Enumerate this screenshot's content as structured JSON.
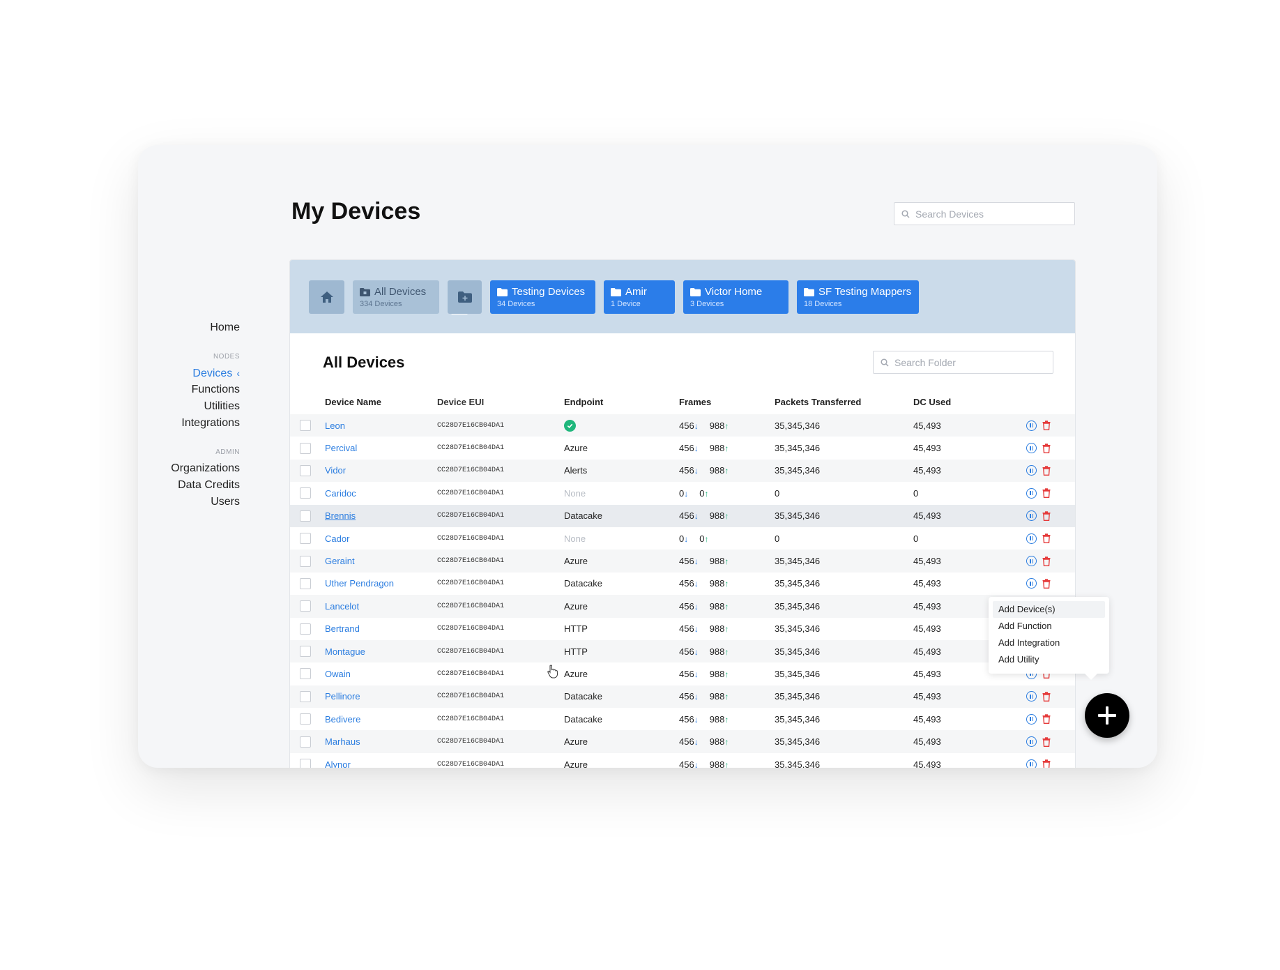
{
  "header": {
    "title": "My Devices",
    "search_placeholder": "Search Devices"
  },
  "sidebar": {
    "home": "Home",
    "nodes_label": "NODES",
    "nodes": [
      "Devices",
      "Functions",
      "Utilities",
      "Integrations"
    ],
    "admin_label": "ADMIN",
    "admin": [
      "Organizations",
      "Data Credits",
      "Users"
    ]
  },
  "folders": {
    "all": {
      "title": "All Devices",
      "sub": "334 Devices"
    },
    "items": [
      {
        "title": "Testing Devices",
        "sub": "34 Devices"
      },
      {
        "title": "Amir",
        "sub": "1 Device"
      },
      {
        "title": "Victor Home",
        "sub": "3 Devices"
      },
      {
        "title": "SF Testing Mappers",
        "sub": "18 Devices"
      }
    ]
  },
  "main": {
    "title": "All Devices",
    "search_placeholder": "Search Folder"
  },
  "table": {
    "columns": [
      "Device Name",
      "Device EUI",
      "Endpoint",
      "Frames",
      "Packets Transferred",
      "DC Used"
    ],
    "rows": [
      {
        "name": "Leon",
        "eui": "CC28D7E16CB04DA1",
        "endpoint": "",
        "status_icon": "check-circle",
        "down": "456",
        "up": "988",
        "packets": "35,345,346",
        "dc": "45,493"
      },
      {
        "name": "Percival",
        "eui": "CC28D7E16CB04DA1",
        "endpoint": "Azure",
        "down": "456",
        "up": "988",
        "packets": "35,345,346",
        "dc": "45,493"
      },
      {
        "name": "Vidor",
        "eui": "CC28D7E16CB04DA1",
        "endpoint": "Alerts",
        "down": "456",
        "up": "988",
        "packets": "35,345,346",
        "dc": "45,493"
      },
      {
        "name": "Caridoc",
        "eui": "CC28D7E16CB04DA1",
        "endpoint": "None",
        "muted": true,
        "down": "0",
        "up": "0",
        "packets": "0",
        "dc": "0"
      },
      {
        "name": "Brennis",
        "eui": "CC28D7E16CB04DA1",
        "endpoint": "Datacake",
        "hovered": true,
        "down": "456",
        "up": "988",
        "packets": "35,345,346",
        "dc": "45,493"
      },
      {
        "name": "Cador",
        "eui": "CC28D7E16CB04DA1",
        "endpoint": "None",
        "muted": true,
        "down": "0",
        "up": "0",
        "packets": "0",
        "dc": "0"
      },
      {
        "name": "Geraint",
        "eui": "CC28D7E16CB04DA1",
        "endpoint": "Azure",
        "down": "456",
        "up": "988",
        "packets": "35,345,346",
        "dc": "45,493"
      },
      {
        "name": "Uther Pendragon",
        "eui": "CC28D7E16CB04DA1",
        "endpoint": "Datacake",
        "down": "456",
        "up": "988",
        "packets": "35,345,346",
        "dc": "45,493"
      },
      {
        "name": "Lancelot",
        "eui": "CC28D7E16CB04DA1",
        "endpoint": "Azure",
        "down": "456",
        "up": "988",
        "packets": "35,345,346",
        "dc": "45,493"
      },
      {
        "name": "Bertrand",
        "eui": "CC28D7E16CB04DA1",
        "endpoint": "HTTP",
        "down": "456",
        "up": "988",
        "packets": "35,345,346",
        "dc": "45,493"
      },
      {
        "name": "Montague",
        "eui": "CC28D7E16CB04DA1",
        "endpoint": "HTTP",
        "down": "456",
        "up": "988",
        "packets": "35,345,346",
        "dc": "45,493"
      },
      {
        "name": "Owain",
        "eui": "CC28D7E16CB04DA1",
        "endpoint": "Azure",
        "down": "456",
        "up": "988",
        "packets": "35,345,346",
        "dc": "45,493"
      },
      {
        "name": "Pellinore",
        "eui": "CC28D7E16CB04DA1",
        "endpoint": "Datacake",
        "down": "456",
        "up": "988",
        "packets": "35,345,346",
        "dc": "45,493"
      },
      {
        "name": "Bedivere",
        "eui": "CC28D7E16CB04DA1",
        "endpoint": "Datacake",
        "down": "456",
        "up": "988",
        "packets": "35,345,346",
        "dc": "45,493"
      },
      {
        "name": "Marhaus",
        "eui": "CC28D7E16CB04DA1",
        "endpoint": "Azure",
        "down": "456",
        "up": "988",
        "packets": "35,345,346",
        "dc": "45,493"
      },
      {
        "name": "Alynor",
        "eui": "CC28D7E16CB04DA1",
        "endpoint": "Azure",
        "down": "456",
        "up": "988",
        "packets": "35,345,346",
        "dc": "45,493"
      }
    ]
  },
  "add_menu": {
    "items": [
      "Add Device(s)",
      "Add Function",
      "Add Integration",
      "Add Utility"
    ]
  },
  "icons": {
    "down_arrow": "↓",
    "up_arrow": "↑",
    "sidebar_chevron": "‹"
  },
  "colors": {
    "accent": "#2b7de0",
    "folder_blue": "#2b7de9",
    "folder_bar": "#cbdbea",
    "up_green": "#20b27a",
    "delete_red": "#e53b3b"
  }
}
